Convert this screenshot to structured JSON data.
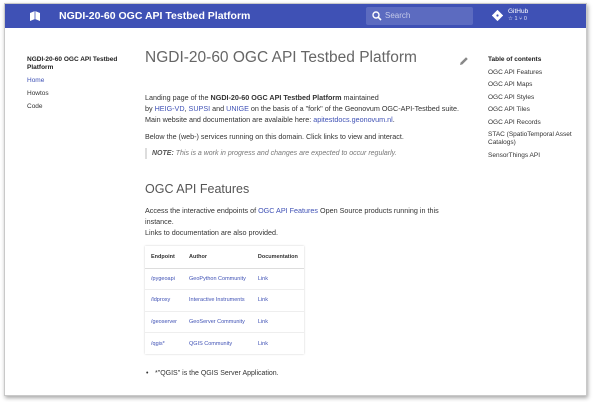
{
  "header": {
    "site_title": "NGDI-20-60 OGC API Testbed Platform",
    "search_placeholder": "Search",
    "repo_name": "GitHub",
    "repo_stats": "☆ 1  ⑂ 0"
  },
  "nav": {
    "title": "NGDI-20-60 OGC API Testbed Platform",
    "items": [
      {
        "label": "Home",
        "active": true
      },
      {
        "label": "Howtos",
        "active": false
      },
      {
        "label": "Code",
        "active": false
      }
    ]
  },
  "toc": {
    "title": "Table of contents",
    "items": [
      "OGC API Features",
      "OGC API Maps",
      "OGC API Styles",
      "OGC API Tiles",
      "OGC API Records",
      "STAC (SpatioTemporal Asset Catalogs)",
      "SensorThings API"
    ]
  },
  "content": {
    "title": "NGDI-20-60 OGC API Testbed Platform",
    "intro_1": "Landing page of the ",
    "intro_bold": "NGDI-20-60 OGC API Testbed Platform",
    "intro_2": " maintained",
    "intro_by": "by ",
    "link_heig": "HEIG-VD",
    "sep1": ", ",
    "link_supsi": "SUPSI",
    "sep2": " and ",
    "link_unige": "UNIGE",
    "intro_3": " on the basis of a \"fork\" of the Geonovum OGC-API-Testbed suite.",
    "intro_4": "Main website and documentation are avalaible here: ",
    "link_docs": "apitestdocs.geonovum.nl",
    "intro_5": ".",
    "services_text": "Below the (web-) services running on this domain. Click links to view and interact.",
    "note_label": "NOTE:",
    "note_text": " This is a work in progress and changes are expected to occur regularly.",
    "section_title": "OGC API Features",
    "section_p1_a": "Access the interactive endpoints of ",
    "section_link": "OGC API Features",
    "section_p1_b": " Open Source products running in this",
    "section_p1_c": "instance.",
    "section_p2": "Links to documentation are also provided.",
    "table": {
      "headers": [
        "Endpoint",
        "Author",
        "Documentation"
      ],
      "rows": [
        [
          "/pygeoapi",
          "GeoPython Community",
          "Link"
        ],
        [
          "/ldproxy",
          "Interactive Instruments",
          "Link"
        ],
        [
          "/geoserver",
          "GeoServer Community",
          "Link"
        ],
        [
          "/qgis*",
          "QGIS Community",
          "Link"
        ]
      ]
    },
    "bullet": "*\"QGIS\" is the QGIS Server Application."
  }
}
